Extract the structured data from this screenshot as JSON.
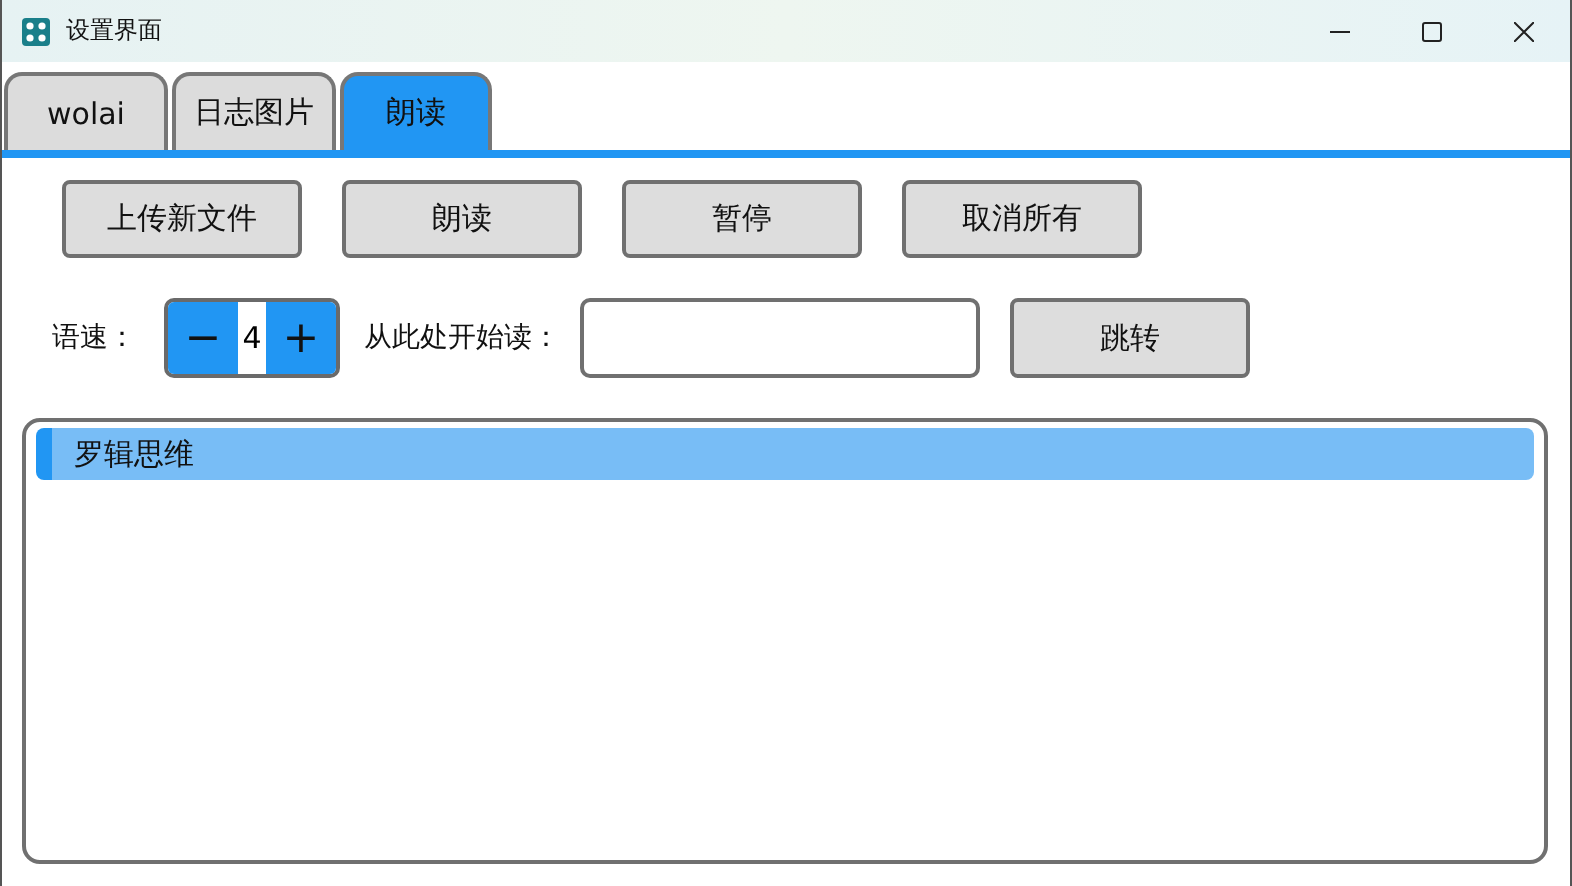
{
  "window": {
    "title": "设置界面"
  },
  "tabs": [
    {
      "label": "wolai",
      "selected": false
    },
    {
      "label": "日志图片",
      "selected": false
    },
    {
      "label": "朗读",
      "selected": true
    }
  ],
  "actions": [
    "上传新文件",
    "朗读",
    "暂停",
    "取消所有"
  ],
  "speed": {
    "label": "语速：",
    "decrement": "−",
    "value": "4",
    "increment": "+"
  },
  "start_from": {
    "label": "从此处开始读："
  },
  "jump_button": "跳转",
  "list": {
    "items": [
      {
        "label": "罗辑思维",
        "selected": true
      }
    ]
  }
}
